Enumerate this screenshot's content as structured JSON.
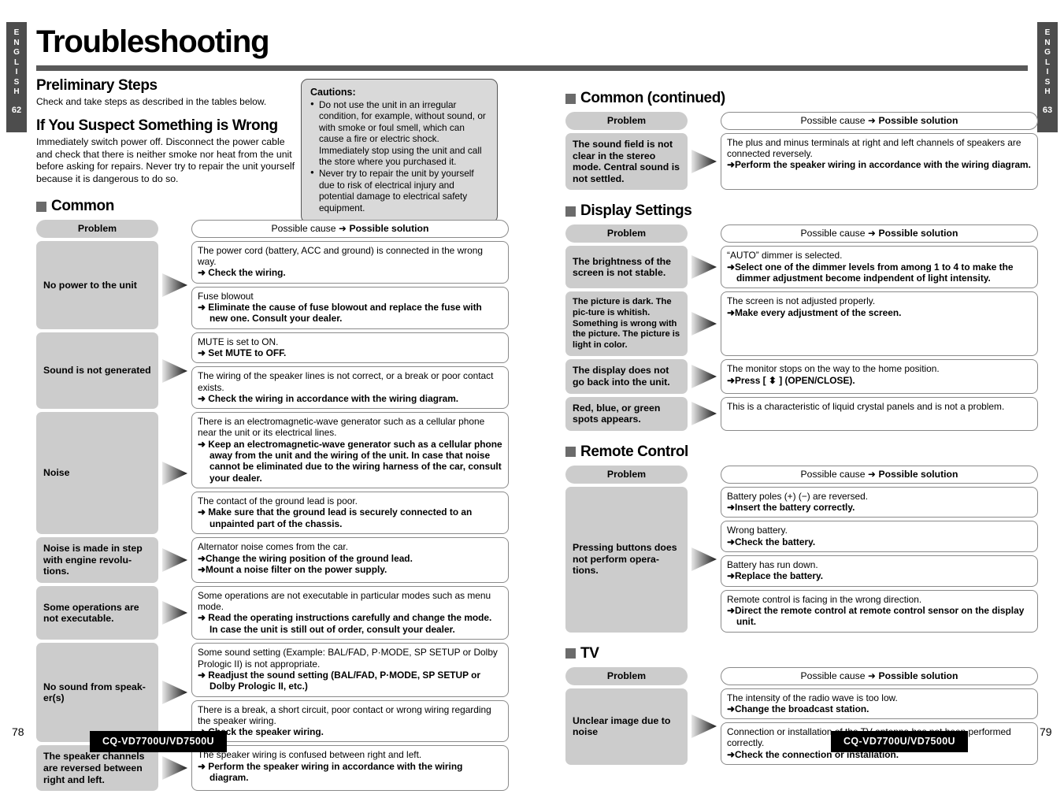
{
  "document": {
    "title": "Troubleshooting",
    "model_badge": "CQ-VD7700U/VD7500U",
    "left_tab": {
      "language": "ENGLISH",
      "page": "62"
    },
    "right_tab": {
      "language": "ENGLISH",
      "page": "63"
    },
    "footer_left_page": "78",
    "footer_right_page": "79"
  },
  "colors": {
    "tab_bg": "#4d4d4d",
    "rule": "#595959",
    "pill_gray": "#cccccc",
    "caution_bg": "#d9d9d9",
    "square_bullet": "#6b6b6b",
    "border": "#8a8a8a"
  },
  "intro": {
    "preliminary_heading": "Preliminary Steps",
    "preliminary_text": "Check and take steps as described in the tables below.",
    "suspect_heading": "If You Suspect Something is Wrong",
    "suspect_text": "Immediately switch power off.\nDisconnect the power cable and check that there is neither smoke nor heat from the unit before asking for repairs. Never try to repair the unit yourself because it is dangerous to do so."
  },
  "cautions": {
    "heading": "Cautions:",
    "items": [
      "Do not use the unit in an irregular condition, for example, without sound, or with smoke or foul smell, which can cause a fire or electric shock. Immediately stop using the unit and call the store where you purchased it.",
      "Never try to repair the unit by yourself due to risk of electrical injury and potential damage to electrical safety equipment."
    ]
  },
  "table_headers": {
    "problem": "Problem",
    "cause_prefix": "Possible cause",
    "cause_arrow": "➜",
    "cause_suffix": "Possible solution"
  },
  "sections": [
    {
      "id": "common",
      "title": "Common",
      "rows": [
        {
          "problem": "No power to the unit",
          "solutions": [
            {
              "cause": "The power cord (battery, ACC and ground) is connected in the wrong way.",
              "fix": "➜ Check the wiring."
            },
            {
              "cause": "Fuse blowout",
              "fix": "➜ Eliminate the cause of fuse blowout and replace the fuse with new one. Consult your dealer."
            }
          ]
        },
        {
          "problem": "Sound is not generated",
          "solutions": [
            {
              "cause": "MUTE is set to ON.",
              "fix": "➜ Set MUTE to OFF."
            },
            {
              "cause": "The wiring of the speaker lines is not correct, or a break or poor contact exists.",
              "fix": "➜ Check the wiring in accordance with the wiring diagram."
            }
          ]
        },
        {
          "problem": "Noise",
          "solutions": [
            {
              "cause": "There is an electromagnetic-wave generator such as a cellular phone near the unit or its electrical lines.",
              "fix": "➜ Keep an electromagnetic-wave generator such as a cellular phone away from the unit and the wiring of the unit. In case that noise cannot be eliminated due to the wiring harness of the car, consult your dealer."
            },
            {
              "cause": "The contact of the ground lead is poor.",
              "fix": "➜ Make sure that the ground lead is  securely connected to an unpainted part of the chassis."
            }
          ]
        },
        {
          "problem": "Noise is made in step with engine revolu-tions.",
          "solutions": [
            {
              "cause": "Alternator noise comes from the car.",
              "fix": "➜Change the wiring position of the ground lead.",
              "fix2": "➜Mount a noise filter on the power supply."
            }
          ]
        },
        {
          "problem": "Some operations are not executable.",
          "solutions": [
            {
              "cause": "Some operations are not executable in particular modes such as menu mode.",
              "fix": "➜ Read the operating instructions carefully and change the mode. In case the unit is still out of order, consult your dealer."
            }
          ]
        },
        {
          "problem": "No sound from speak-er(s)",
          "solutions": [
            {
              "cause": "Some sound setting (Example: BAL/FAD, P·MODE, SP SETUP or Dolby Prologic II) is not appropriate.",
              "fix": "➜ Readjust the sound setting (BAL/FAD, P·MODE, SP SETUP or Dolby Prologic II, etc.)"
            },
            {
              "cause": "There is a break, a short circuit, poor contact or wrong wiring regarding the speaker wiring.",
              "fix": "➜ Check the speaker wiring."
            }
          ]
        },
        {
          "problem": "The speaker channels are reversed between right and left.",
          "solutions": [
            {
              "cause": "The speaker wiring is confused between right and left.",
              "fix": "➜ Perform the speaker wiring in accordance with the wiring diagram."
            }
          ]
        }
      ]
    },
    {
      "id": "common-continued",
      "title": "Common (continued)",
      "rows": [
        {
          "problem": "The sound field is not clear in the stereo mode. Central sound is not settled.",
          "solutions": [
            {
              "cause": "The plus and minus terminals at right and left channels of speakers are connected reversely.",
              "fix": "➜Perform the speaker wiring in accordance with the wiring diagram."
            }
          ]
        }
      ]
    },
    {
      "id": "display-settings",
      "title": "Display Settings",
      "rows": [
        {
          "problem": "The brightness of the screen is not stable.",
          "solutions": [
            {
              "cause": "“AUTO” dimmer is selected.",
              "fix": "➜Select one of the dimmer levels from among 1 to 4 to make the dimmer adjustment become indpendent of light intensity."
            }
          ]
        },
        {
          "problem": "The picture is dark. The pic-ture is whitish. Something is wrong with the picture. The picture is light in color.",
          "small": true,
          "solutions": [
            {
              "cause": "The screen is not adjusted properly.",
              "fix": "➜Make every adjustment of the screen."
            }
          ]
        },
        {
          "problem": "The display does not go back into the unit.",
          "solutions": [
            {
              "cause": "The monitor stops on the way to the home position.",
              "fix": "➜Press [ ⬍ ] (OPEN/CLOSE)."
            }
          ]
        },
        {
          "problem": "Red, blue, or green spots appears.",
          "solutions": [
            {
              "cause": "This is a characteristic of liquid crystal panels and is not a problem.",
              "fix": ""
            }
          ]
        }
      ]
    },
    {
      "id": "remote-control",
      "title": "Remote Control",
      "rows": [
        {
          "problem": "Pressing buttons does not perform opera-tions.",
          "solutions": [
            {
              "cause": "Battery poles (+) (−) are reversed.",
              "fix": "➜Insert the battery correctly."
            },
            {
              "cause": "Wrong battery.",
              "fix": "➜Check the battery."
            },
            {
              "cause": "Battery has run down.",
              "fix": "➜Replace the battery."
            },
            {
              "cause": "Remote control is facing in the wrong direction.",
              "fix": "➜Direct the remote control at remote control sensor on the display unit."
            }
          ]
        }
      ]
    },
    {
      "id": "tv",
      "title": "TV",
      "rows": [
        {
          "problem": "Unclear image due to noise",
          "solutions": [
            {
              "cause": "The intensity of the radio wave is too low.",
              "fix": "➜Change the broadcast station."
            },
            {
              "cause": "Connection or installation of the TV antenna has not been performed correctly.",
              "fix": "➜Check the connection or installation."
            }
          ]
        }
      ]
    }
  ]
}
